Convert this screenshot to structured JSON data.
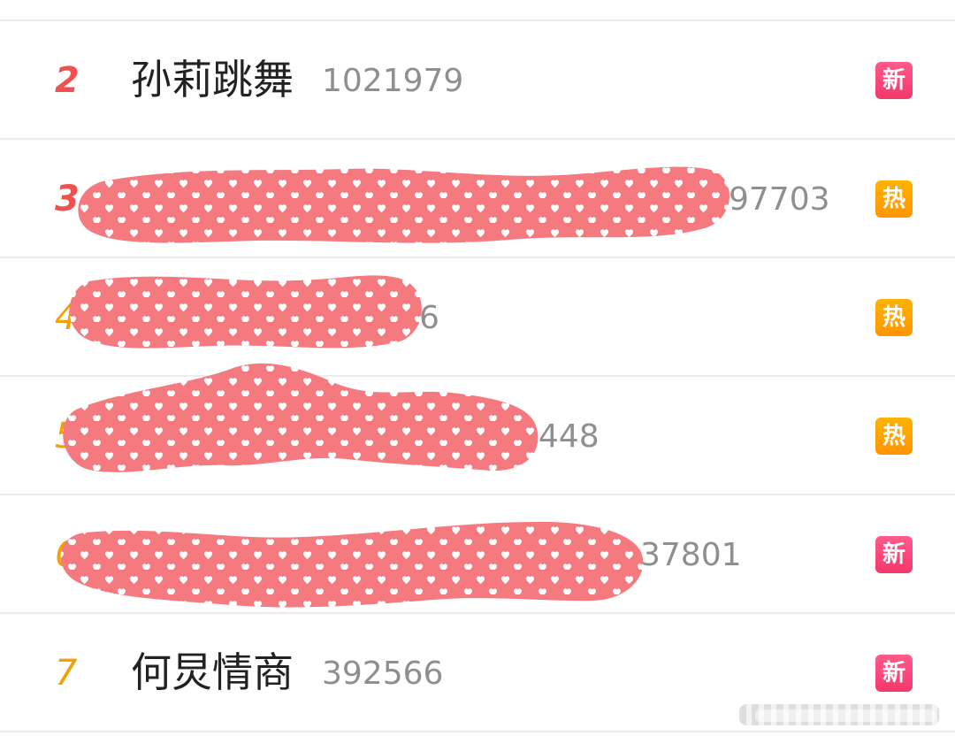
{
  "list": {
    "items": [
      {
        "rank": "2",
        "title": "孙莉跳舞",
        "count": "1021979",
        "badge": "新"
      },
      {
        "rank": "3",
        "title": "",
        "count": "97703",
        "badge": "热"
      },
      {
        "rank": "4",
        "title": "",
        "count": "6",
        "badge": "热"
      },
      {
        "rank": "5",
        "title": "",
        "count": "6448",
        "badge": "热"
      },
      {
        "rank": "6",
        "title": "",
        "count": "37801",
        "badge": "新"
      },
      {
        "rank": "7",
        "title": "何炅情商",
        "count": "392566",
        "badge": "新"
      }
    ]
  },
  "colors": {
    "rank_top": "#f0514f",
    "rank_other": "#f3a000",
    "badge_new": "#f3386c",
    "badge_hot": "#ff9500",
    "redaction": "#f47a80"
  }
}
